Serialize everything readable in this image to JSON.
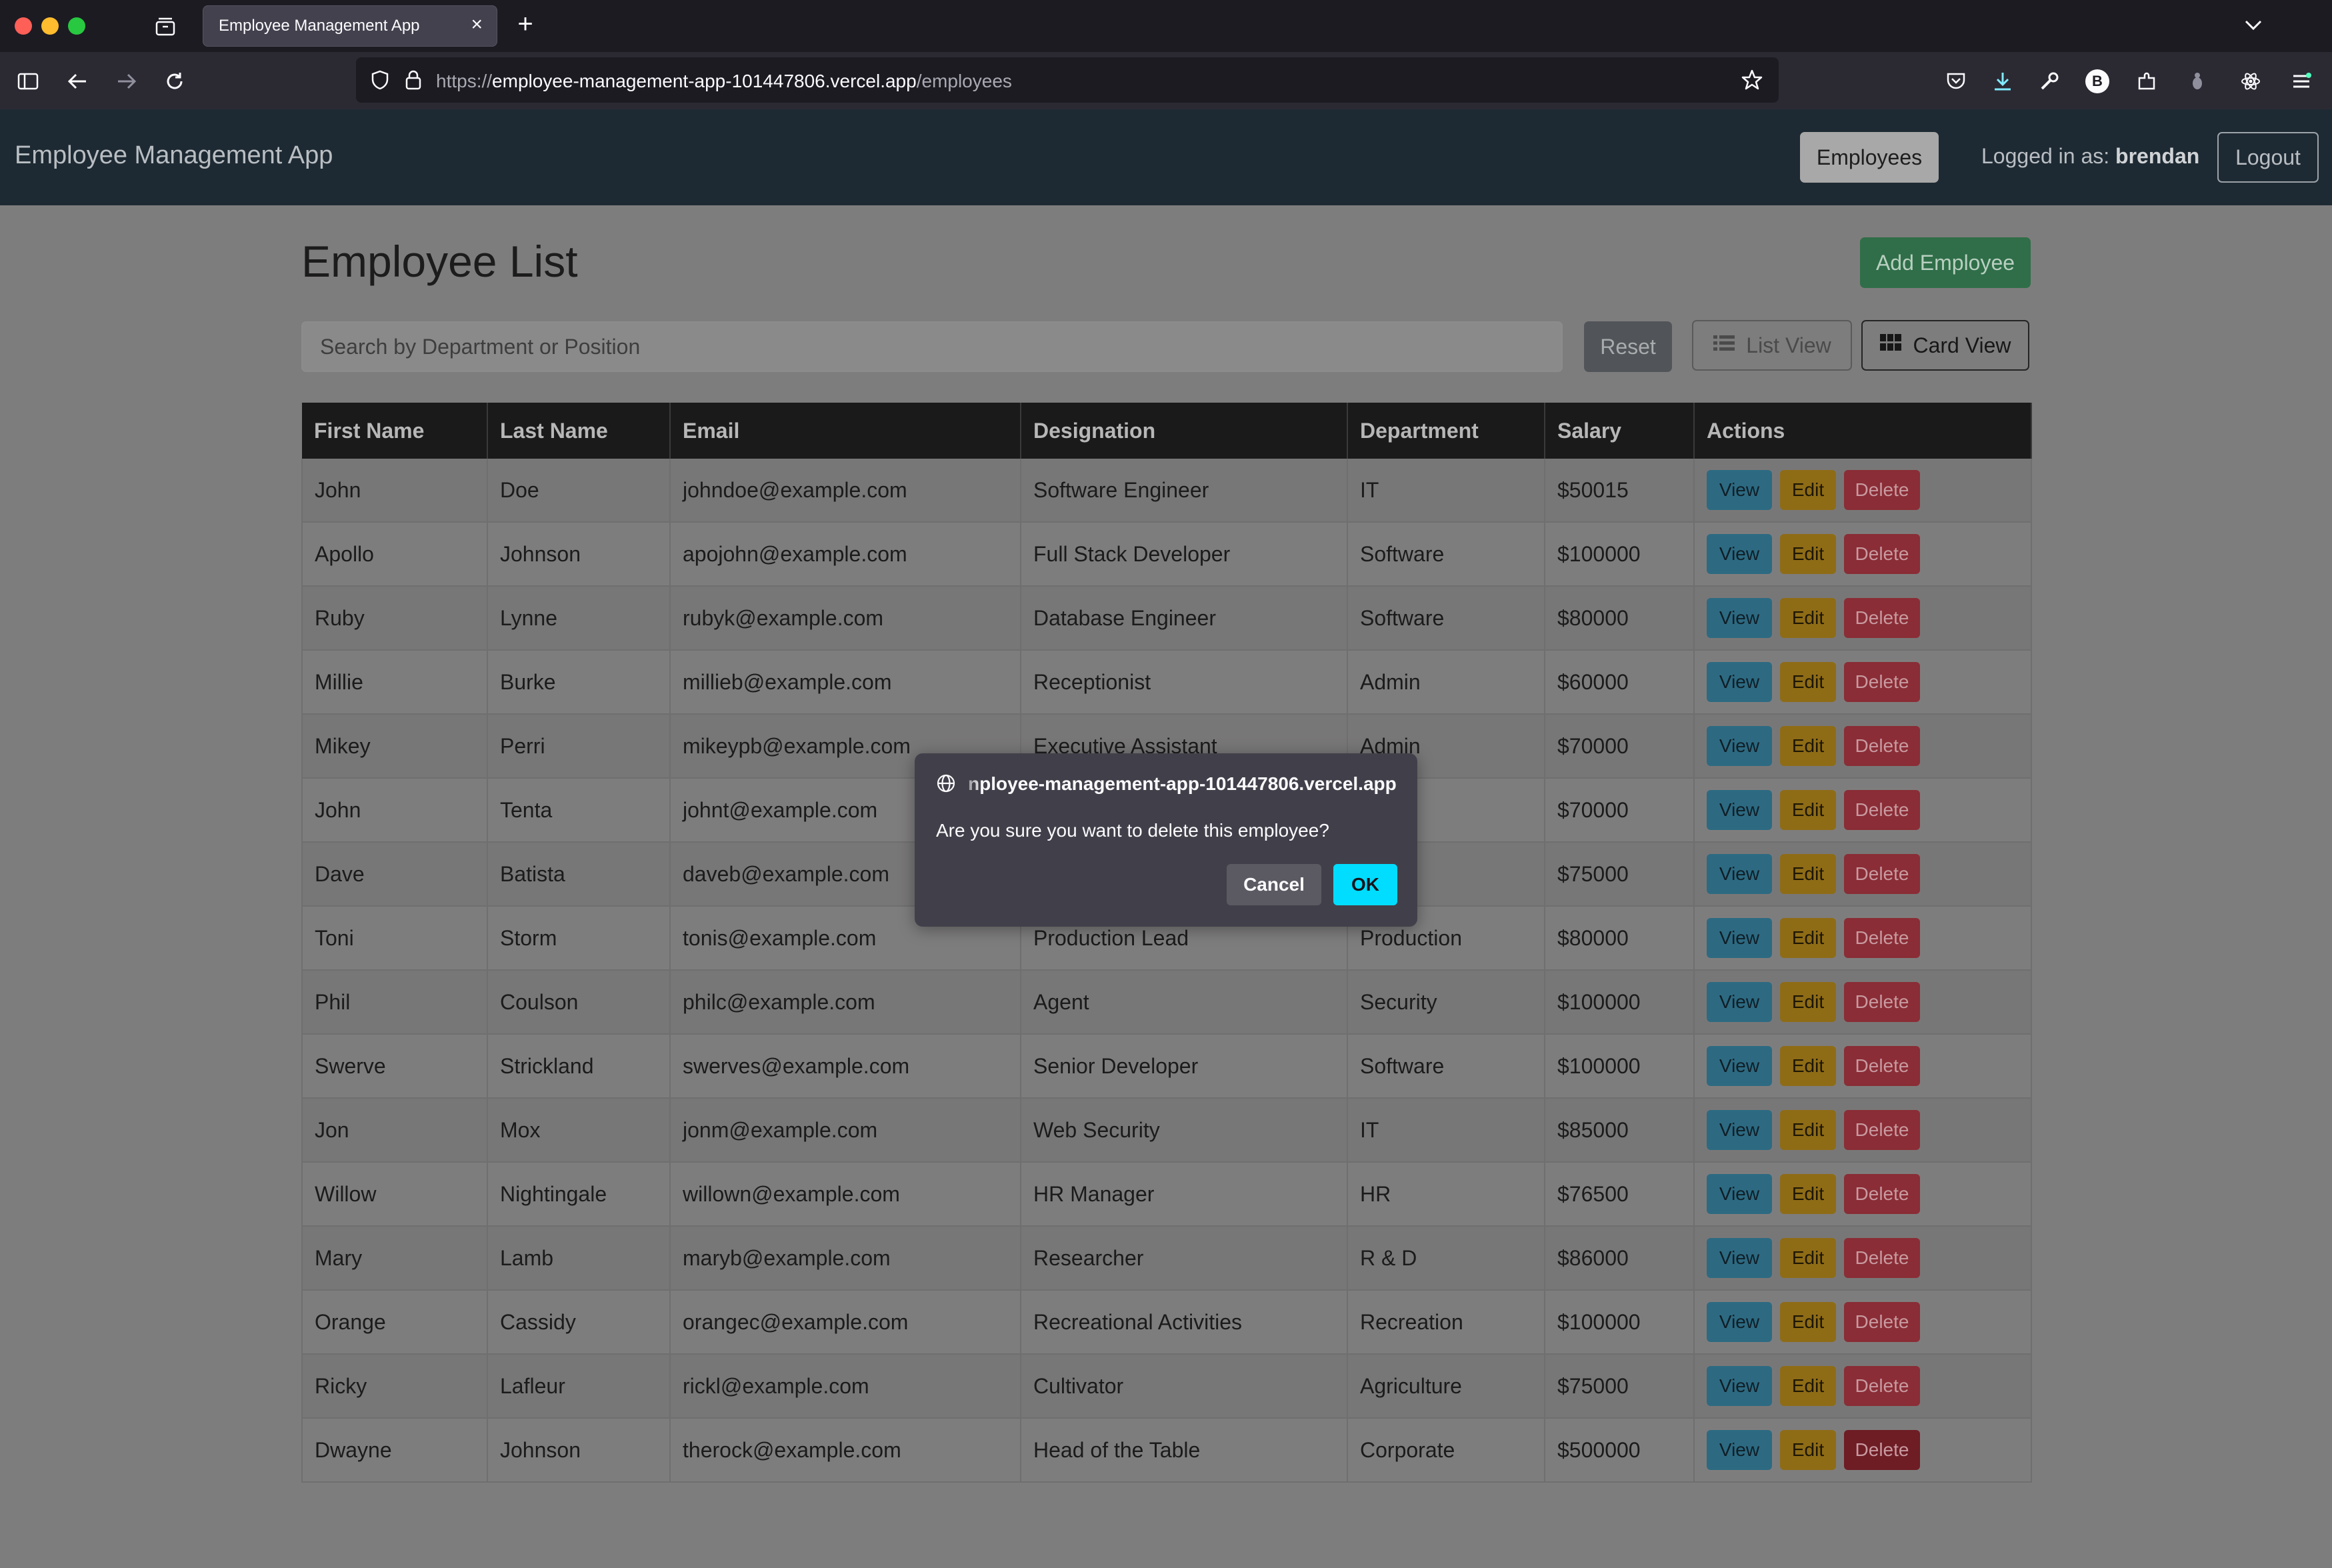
{
  "browser": {
    "tab_title": "Employee Management App",
    "tab_close": "×",
    "new_tab": "+",
    "url_prefix": "https://",
    "url_host": "employee-management-app-101447806.vercel.app",
    "url_path": "/employees",
    "account_letter": "B"
  },
  "header": {
    "brand": "Employee Management App",
    "employees_label": "Employees",
    "logged_prefix": "Logged in as: ",
    "username": "brendan",
    "logout_label": "Logout"
  },
  "main": {
    "title": "Employee List",
    "add_label": "Add Employee",
    "search_placeholder": "Search by Department or Position",
    "reset_label": "Reset",
    "list_view_label": "List View",
    "card_view_label": "Card View"
  },
  "table": {
    "columns": [
      "First Name",
      "Last Name",
      "Email",
      "Designation",
      "Department",
      "Salary",
      "Actions"
    ],
    "actions": {
      "view": "View",
      "edit": "Edit",
      "delete": "Delete"
    },
    "rows": [
      [
        "John",
        "Doe",
        "johndoe@example.com",
        "Software Engineer",
        "IT",
        "$50015"
      ],
      [
        "Apollo",
        "Johnson",
        "apojohn@example.com",
        "Full Stack Developer",
        "Software",
        "$100000"
      ],
      [
        "Ruby",
        "Lynne",
        "rubyk@example.com",
        "Database Engineer",
        "Software",
        "$80000"
      ],
      [
        "Millie",
        "Burke",
        "millieb@example.com",
        "Receptionist",
        "Admin",
        "$60000"
      ],
      [
        "Mikey",
        "Perri",
        "mikeypb@example.com",
        "Executive Assistant",
        "Admin",
        "$70000"
      ],
      [
        "John",
        "Tenta",
        "johnt@example.com",
        "",
        "are",
        "$70000"
      ],
      [
        "Dave",
        "Batista",
        "daveb@example.com",
        "",
        "ty",
        "$75000"
      ],
      [
        "Toni",
        "Storm",
        "tonis@example.com",
        "Production Lead",
        "Production",
        "$80000"
      ],
      [
        "Phil",
        "Coulson",
        "philc@example.com",
        "Agent",
        "Security",
        "$100000"
      ],
      [
        "Swerve",
        "Strickland",
        "swerves@example.com",
        "Senior Developer",
        "Software",
        "$100000"
      ],
      [
        "Jon",
        "Mox",
        "jonm@example.com",
        "Web Security",
        "IT",
        "$85000"
      ],
      [
        "Willow",
        "Nightingale",
        "willown@example.com",
        "HR Manager",
        "HR",
        "$76500"
      ],
      [
        "Mary",
        "Lamb",
        "maryb@example.com",
        "Researcher",
        "R & D",
        "$86000"
      ],
      [
        "Orange",
        "Cassidy",
        "orangec@example.com",
        "Recreational Activities",
        "Recreation",
        "$100000"
      ],
      [
        "Ricky",
        "Lafleur",
        "rickl@example.com",
        "Cultivator",
        "Agriculture",
        "$75000"
      ],
      [
        "Dwayne",
        "Johnson",
        "therock@example.com",
        "Head of the Table",
        "Corporate",
        "$500000"
      ]
    ]
  },
  "dialog": {
    "origin": "nployee-management-app-101447806.vercel.app",
    "message": "Are you sure you want to delete this employee?",
    "cancel_label": "Cancel",
    "ok_label": "OK"
  },
  "colors": {
    "header_bg": "#1e2a33",
    "ok_button": "#00ddff",
    "add_button": "#2f6e48",
    "view_button": "#2d6a82",
    "edit_button": "#8e6c16",
    "delete_button": "#8a2d36"
  }
}
